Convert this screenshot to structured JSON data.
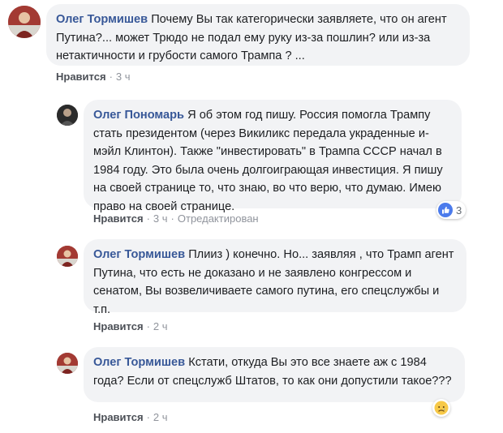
{
  "comments": [
    {
      "author": "Олег Тормишев",
      "text": " Почему Вы так категорически заявляете, что он агент Путина?... может Трюдо не подал ему руку из-за пошлин? или из-за нетактичности и грубости самого Трампа ? ...",
      "like_label": "Нравится",
      "time": "3 ч"
    },
    {
      "author": "Олег Пономарь",
      "text": " Я об этом год пишу. Россия помогла Трампу стать президентом (через Викиликс передала украденные и-мэйл Клинтон). Также \"инвестировать\" в Трампа СССР начал в 1984 году. Это была очень долгоиграющая инвестиция. Я пишу на своей странице то, что знаю, во что верю, что думаю. Имею право на своей странице.",
      "like_label": "Нравится",
      "time": "3 ч",
      "edited": "Отредактирован",
      "reaction_icon": "like-icon",
      "reaction_count": "3"
    },
    {
      "author": "Олег Тормишев",
      "text": " Плииз ) конечно. Но... заявляя , что Трамп агент Путина, что есть не доказано и не заявлено конгрессом и сенатом, Вы возвеличиваете самого путина, его спецслужбы и т.п.",
      "like_label": "Нравится",
      "time": "2 ч"
    },
    {
      "author": "Олег Тормишев",
      "text": " Кстати, откуда Вы это все знаете аж с 1984 года? Если от спецслужб Штатов, то как они допустили такое???",
      "like_label": "Нравится",
      "time": "2 ч",
      "reaction_icon": "sad-reaction-icon"
    }
  ],
  "separator": "·",
  "colors": {
    "author": "#385898",
    "bubble": "#f2f3f5",
    "meta": "#90949c",
    "like_blue": "#4b7bec",
    "sad_yellow": "#f7c948"
  }
}
